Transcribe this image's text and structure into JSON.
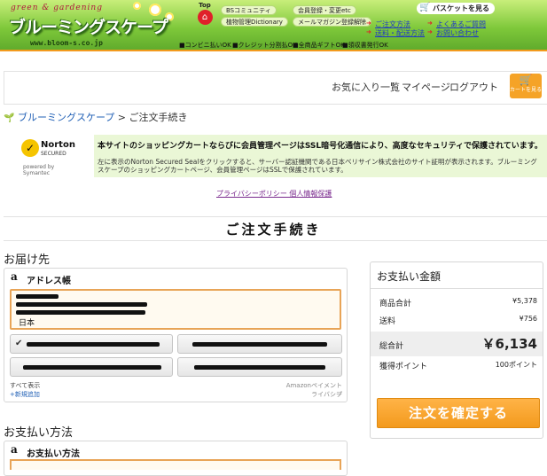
{
  "header": {
    "logo_tagline": "green & gardening",
    "logo_title": "ブルーミングスケープ",
    "logo_url": "www.bloom-s.co.jp",
    "top_label": "Top",
    "pills": [
      "BSコミュニティ",
      "会員登録・変更etc",
      "植物管理Dictionary",
      "メールマガジン登録解除"
    ],
    "basket_label": "バスケットを見る",
    "links": [
      "ご注文方法",
      "よくあるご質問",
      "送料・配送方法",
      "お問い合わせ"
    ],
    "bar_items": [
      "■コンビニ払いOK",
      "■クレジット分割払OK",
      "■全商品ギフトOK",
      "■領収書発行OK"
    ]
  },
  "nav": {
    "favorites": "お気に入り一覧",
    "mypage": "マイページ",
    "logout": "ログアウト",
    "cart_label": "カートを見る"
  },
  "breadcrumb": {
    "home": "ブルーミングスケープ",
    "separator": ">",
    "current": "ご注文手続き"
  },
  "ssl": {
    "norton_name": "Norton",
    "norton_secured": "SECURED",
    "norton_by": "powered by Symantec",
    "title": "本サイトのショッピングカートならびに会員管理ページはSSL暗号化通信により、高度なセキュリティで保護されています。",
    "body": "左に表示のNorton Secured Sealをクリックすると、サーバー認証機関である日本ベリサイン株式会社のサイト証明が表示されます。ブルーミングスケープのショッピングカートページ、会員管理ページはSSLで保護されています。",
    "privacy_link": "プライバシーポリシー 個人情報保護"
  },
  "page_title": "ご注文手続き",
  "delivery": {
    "section_title": "お届け先",
    "amazon_glyph": "a",
    "card_title": "アドレス帳",
    "country": "日本",
    "check_glyph": "✔",
    "show_all": "すべて表示",
    "add_new": "+新規追加",
    "amazon_info": "Amazonペイメントプ",
    "amazon_privacy": "ライバシー"
  },
  "payment": {
    "section_title": "お支払い方法",
    "amazon_glyph": "a",
    "card_title": "お支払い方法"
  },
  "summary": {
    "title": "お支払い金額",
    "rows": [
      {
        "label": "商品合計",
        "value": "¥5,378"
      },
      {
        "label": "送料",
        "value": "¥756"
      }
    ],
    "total_label": "総合計",
    "total_value": "￥6,134",
    "points_label": "獲得ポイント",
    "points_value": "100ポイント",
    "confirm_button": "注文を確定する"
  },
  "colors": {
    "header_green": "#7ec83a",
    "accent_orange": "#f39a1d",
    "ssl_bg": "#eaf7d6",
    "link_blue": "#1f5fb5"
  }
}
